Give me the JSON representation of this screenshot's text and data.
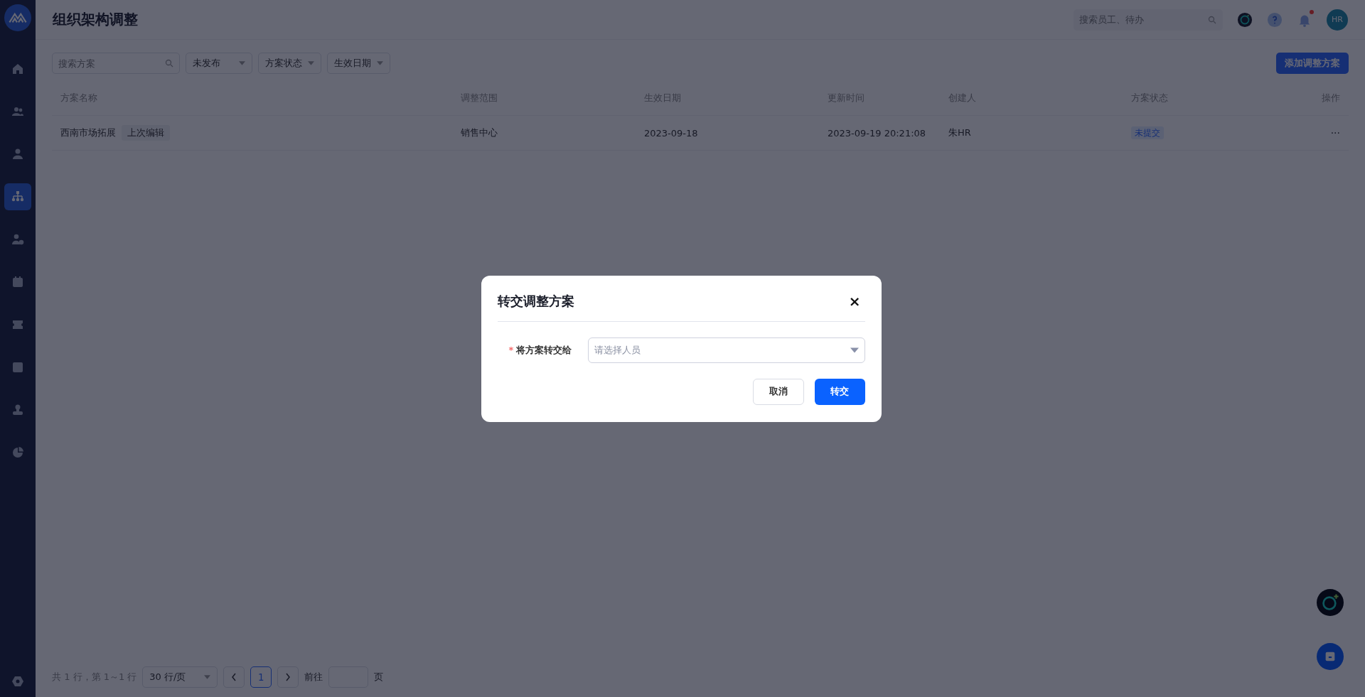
{
  "sidebar": {
    "items": [
      {
        "selected": false
      },
      {
        "selected": false
      },
      {
        "selected": false
      },
      {
        "selected": true
      },
      {
        "selected": false
      },
      {
        "selected": false
      },
      {
        "selected": false
      },
      {
        "selected": false
      },
      {
        "selected": false
      },
      {
        "selected": false
      }
    ]
  },
  "header": {
    "title": "组织架构调整",
    "search": {
      "placeholder": "搜索员工、待办"
    },
    "notification": {
      "unread": true
    },
    "avatar": "HR"
  },
  "filters": {
    "search": {
      "placeholder": "搜索方案"
    },
    "dropdowns": [
      "未发布",
      "方案状态",
      "生效日期"
    ],
    "add_button": "添加调整方案"
  },
  "table": {
    "columns": [
      "方案名称",
      "调整范围",
      "生效日期",
      "更新时间",
      "创建人",
      "方案状态",
      "操作"
    ],
    "rows": [
      {
        "name": "西南市场拓展",
        "tag": "上次编辑",
        "scope": "销售中心",
        "date": "2023-09-18",
        "updated": "2023-09-19 20:21:08",
        "creator": "朱HR",
        "status": "未提交",
        "actions": "···"
      }
    ]
  },
  "pagination": {
    "summary": "共 1 行，第 1～1 行",
    "page_size": "30 行/页",
    "pages": [
      {
        "label": "1",
        "selected": true
      }
    ],
    "goto_label": "前往",
    "goto_suffix": "页"
  },
  "dialog": {
    "title": "转交调整方案",
    "close": "×",
    "field": {
      "required_mark": "*",
      "label": "将方案转交给",
      "placeholder": "请选择人员"
    },
    "buttons": [
      {
        "kind": "secondary",
        "label": "取消"
      },
      {
        "kind": "primary",
        "label": "转交"
      }
    ]
  }
}
